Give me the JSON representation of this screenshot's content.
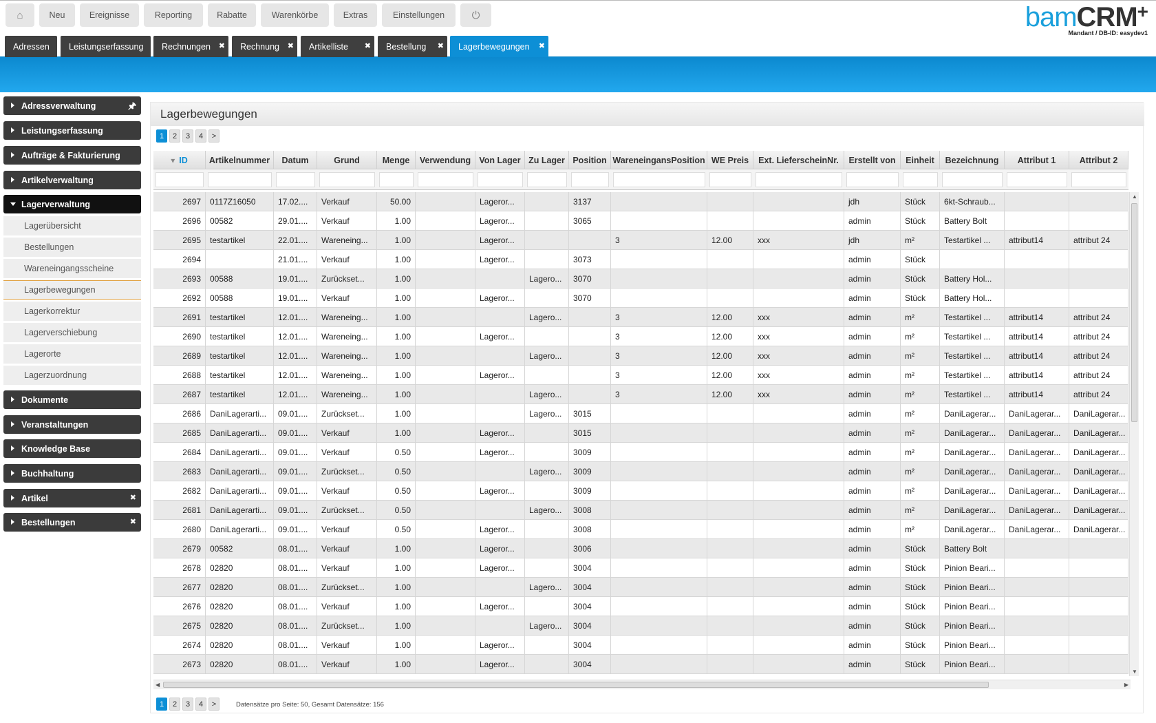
{
  "topnav": {
    "home_icon": "home-icon",
    "items": [
      "Neu",
      "Ereignisse",
      "Reporting",
      "Rabatte",
      "Warenkörbe",
      "Extras",
      "Einstellungen"
    ],
    "power_icon": "power-icon"
  },
  "logo": {
    "bam": "bam",
    "crm": "CRM",
    "plus": "+",
    "mandant": "Mandant / DB-ID: easydev1"
  },
  "tabs": [
    {
      "label": "Adressen",
      "closable": false
    },
    {
      "label": "Leistungserfassung",
      "closable": false
    },
    {
      "label": "Rechnungen",
      "closable": true
    },
    {
      "label": "Rechnung",
      "closable": true
    },
    {
      "label": "Artikelliste",
      "closable": true
    },
    {
      "label": "Bestellung",
      "closable": true
    },
    {
      "label": "Lagerbewegungen",
      "closable": true,
      "active": true
    }
  ],
  "sidebar": {
    "groups": [
      {
        "label": "Adressverwaltung",
        "icon": "pin-icon"
      },
      {
        "label": "Leistungserfassung"
      },
      {
        "label": "Aufträge & Fakturierung"
      },
      {
        "label": "Artikelverwaltung"
      },
      {
        "label": "Lagerverwaltung",
        "open": true
      },
      {
        "label": "Dokumente"
      },
      {
        "label": "Veranstaltungen"
      },
      {
        "label": "Knowledge Base"
      },
      {
        "label": "Buchhaltung"
      },
      {
        "label": "Artikel",
        "closable": true
      },
      {
        "label": "Bestellungen",
        "closable": true
      }
    ],
    "subitems": [
      "Lagerübersicht",
      "Bestellungen",
      "Wareneingangsscheine",
      "Lagerbewegungen",
      "Lagerkorrektur",
      "Lagerverschiebung",
      "Lagerorte",
      "Lagerzuordnung"
    ],
    "active_subitem": "Lagerbewegungen"
  },
  "panel": {
    "title": "Lagerbewegungen",
    "pages": [
      "1",
      "2",
      "3",
      "4"
    ],
    "current_page": "1",
    "next": ">",
    "footer_info": "Datensätze pro Seite: 50, Gesamt Datensätze: 156"
  },
  "grid": {
    "sort_icon": "sort-descending-icon",
    "columns": [
      "ID",
      "Artikelnummer",
      "Datum",
      "Grund",
      "Menge",
      "Verwendung",
      "Von Lager",
      "Zu Lager",
      "Position",
      "WareneingansPosition",
      "WE Preis",
      "Ext. LieferscheinNr.",
      "Erstellt von",
      "Einheit",
      "Bezeichnung",
      "Attribut 1",
      "Attribut 2"
    ],
    "rows": [
      [
        "2697",
        "0117Z16050",
        "17.02....",
        "Verkauf",
        "50.00",
        "",
        "Lageror...",
        "",
        "3137",
        "",
        "",
        "",
        "jdh",
        "Stück",
        "6kt-Schraub...",
        "",
        ""
      ],
      [
        "2696",
        "00582",
        "29.01....",
        "Verkauf",
        "1.00",
        "",
        "Lageror...",
        "",
        "3065",
        "",
        "",
        "",
        "admin",
        "Stück",
        "Battery Bolt",
        "",
        ""
      ],
      [
        "2695",
        "testartikel",
        "22.01....",
        "Wareneing...",
        "1.00",
        "",
        "Lageror...",
        "",
        "",
        "3",
        "12.00",
        "xxx",
        "jdh",
        "m²",
        "Testartikel ...",
        "attribut14",
        "attribut 24"
      ],
      [
        "2694",
        "",
        "21.01....",
        "Verkauf",
        "1.00",
        "",
        "Lageror...",
        "",
        "3073",
        "",
        "",
        "",
        "admin",
        "Stück",
        "",
        "",
        ""
      ],
      [
        "2693",
        "00588",
        "19.01....",
        "Zurückset...",
        "1.00",
        "",
        "",
        "Lagero...",
        "3070",
        "",
        "",
        "",
        "admin",
        "Stück",
        "Battery Hol...",
        "",
        ""
      ],
      [
        "2692",
        "00588",
        "19.01....",
        "Verkauf",
        "1.00",
        "",
        "Lageror...",
        "",
        "3070",
        "",
        "",
        "",
        "admin",
        "Stück",
        "Battery Hol...",
        "",
        ""
      ],
      [
        "2691",
        "testartikel",
        "12.01....",
        "Wareneing...",
        "1.00",
        "",
        "",
        "Lagero...",
        "",
        "3",
        "12.00",
        "xxx",
        "admin",
        "m²",
        "Testartikel ...",
        "attribut14",
        "attribut 24"
      ],
      [
        "2690",
        "testartikel",
        "12.01....",
        "Wareneing...",
        "1.00",
        "",
        "Lageror...",
        "",
        "",
        "3",
        "12.00",
        "xxx",
        "admin",
        "m²",
        "Testartikel ...",
        "attribut14",
        "attribut 24"
      ],
      [
        "2689",
        "testartikel",
        "12.01....",
        "Wareneing...",
        "1.00",
        "",
        "",
        "Lagero...",
        "",
        "3",
        "12.00",
        "xxx",
        "admin",
        "m²",
        "Testartikel ...",
        "attribut14",
        "attribut 24"
      ],
      [
        "2688",
        "testartikel",
        "12.01....",
        "Wareneing...",
        "1.00",
        "",
        "Lageror...",
        "",
        "",
        "3",
        "12.00",
        "xxx",
        "admin",
        "m²",
        "Testartikel ...",
        "attribut14",
        "attribut 24"
      ],
      [
        "2687",
        "testartikel",
        "12.01....",
        "Wareneing...",
        "1.00",
        "",
        "",
        "Lagero...",
        "",
        "3",
        "12.00",
        "xxx",
        "admin",
        "m²",
        "Testartikel ...",
        "attribut14",
        "attribut 24"
      ],
      [
        "2686",
        "DaniLagerarti...",
        "09.01....",
        "Zurückset...",
        "1.00",
        "",
        "",
        "Lagero...",
        "3015",
        "",
        "",
        "",
        "admin",
        "m²",
        "DaniLagerar...",
        "DaniLagerar...",
        "DaniLagerar..."
      ],
      [
        "2685",
        "DaniLagerarti...",
        "09.01....",
        "Verkauf",
        "1.00",
        "",
        "Lageror...",
        "",
        "3015",
        "",
        "",
        "",
        "admin",
        "m²",
        "DaniLagerar...",
        "DaniLagerar...",
        "DaniLagerar..."
      ],
      [
        "2684",
        "DaniLagerarti...",
        "09.01....",
        "Verkauf",
        "0.50",
        "",
        "Lageror...",
        "",
        "3009",
        "",
        "",
        "",
        "admin",
        "m²",
        "DaniLagerar...",
        "DaniLagerar...",
        "DaniLagerar..."
      ],
      [
        "2683",
        "DaniLagerarti...",
        "09.01....",
        "Zurückset...",
        "0.50",
        "",
        "",
        "Lagero...",
        "3009",
        "",
        "",
        "",
        "admin",
        "m²",
        "DaniLagerar...",
        "DaniLagerar...",
        "DaniLagerar..."
      ],
      [
        "2682",
        "DaniLagerarti...",
        "09.01....",
        "Verkauf",
        "0.50",
        "",
        "Lageror...",
        "",
        "3009",
        "",
        "",
        "",
        "admin",
        "m²",
        "DaniLagerar...",
        "DaniLagerar...",
        "DaniLagerar..."
      ],
      [
        "2681",
        "DaniLagerarti...",
        "09.01....",
        "Zurückset...",
        "0.50",
        "",
        "",
        "Lagero...",
        "3008",
        "",
        "",
        "",
        "admin",
        "m²",
        "DaniLagerar...",
        "DaniLagerar...",
        "DaniLagerar..."
      ],
      [
        "2680",
        "DaniLagerarti...",
        "09.01....",
        "Verkauf",
        "0.50",
        "",
        "Lageror...",
        "",
        "3008",
        "",
        "",
        "",
        "admin",
        "m²",
        "DaniLagerar...",
        "DaniLagerar...",
        "DaniLagerar..."
      ],
      [
        "2679",
        "00582",
        "08.01....",
        "Verkauf",
        "1.00",
        "",
        "Lageror...",
        "",
        "3006",
        "",
        "",
        "",
        "admin",
        "Stück",
        "Battery Bolt",
        "",
        ""
      ],
      [
        "2678",
        "02820",
        "08.01....",
        "Verkauf",
        "1.00",
        "",
        "Lageror...",
        "",
        "3004",
        "",
        "",
        "",
        "admin",
        "Stück",
        "Pinion Beari...",
        "",
        ""
      ],
      [
        "2677",
        "02820",
        "08.01....",
        "Zurückset...",
        "1.00",
        "",
        "",
        "Lagero...",
        "3004",
        "",
        "",
        "",
        "admin",
        "Stück",
        "Pinion Beari...",
        "",
        ""
      ],
      [
        "2676",
        "02820",
        "08.01....",
        "Verkauf",
        "1.00",
        "",
        "Lageror...",
        "",
        "3004",
        "",
        "",
        "",
        "admin",
        "Stück",
        "Pinion Beari...",
        "",
        ""
      ],
      [
        "2675",
        "02820",
        "08.01....",
        "Zurückset...",
        "1.00",
        "",
        "",
        "Lagero...",
        "3004",
        "",
        "",
        "",
        "admin",
        "Stück",
        "Pinion Beari...",
        "",
        ""
      ],
      [
        "2674",
        "02820",
        "08.01....",
        "Verkauf",
        "1.00",
        "",
        "Lageror...",
        "",
        "3004",
        "",
        "",
        "",
        "admin",
        "Stück",
        "Pinion Beari...",
        "",
        ""
      ],
      [
        "2673",
        "02820",
        "08.01....",
        "Verkauf",
        "1.00",
        "",
        "Lageror...",
        "",
        "3004",
        "",
        "",
        "",
        "admin",
        "Stück",
        "Pinion Beari...",
        "",
        ""
      ]
    ]
  },
  "colors": {
    "accent": "#0d8fd6",
    "tab_dark": "#3f3f3f",
    "sidebar_dark": "#3b3b3b"
  }
}
